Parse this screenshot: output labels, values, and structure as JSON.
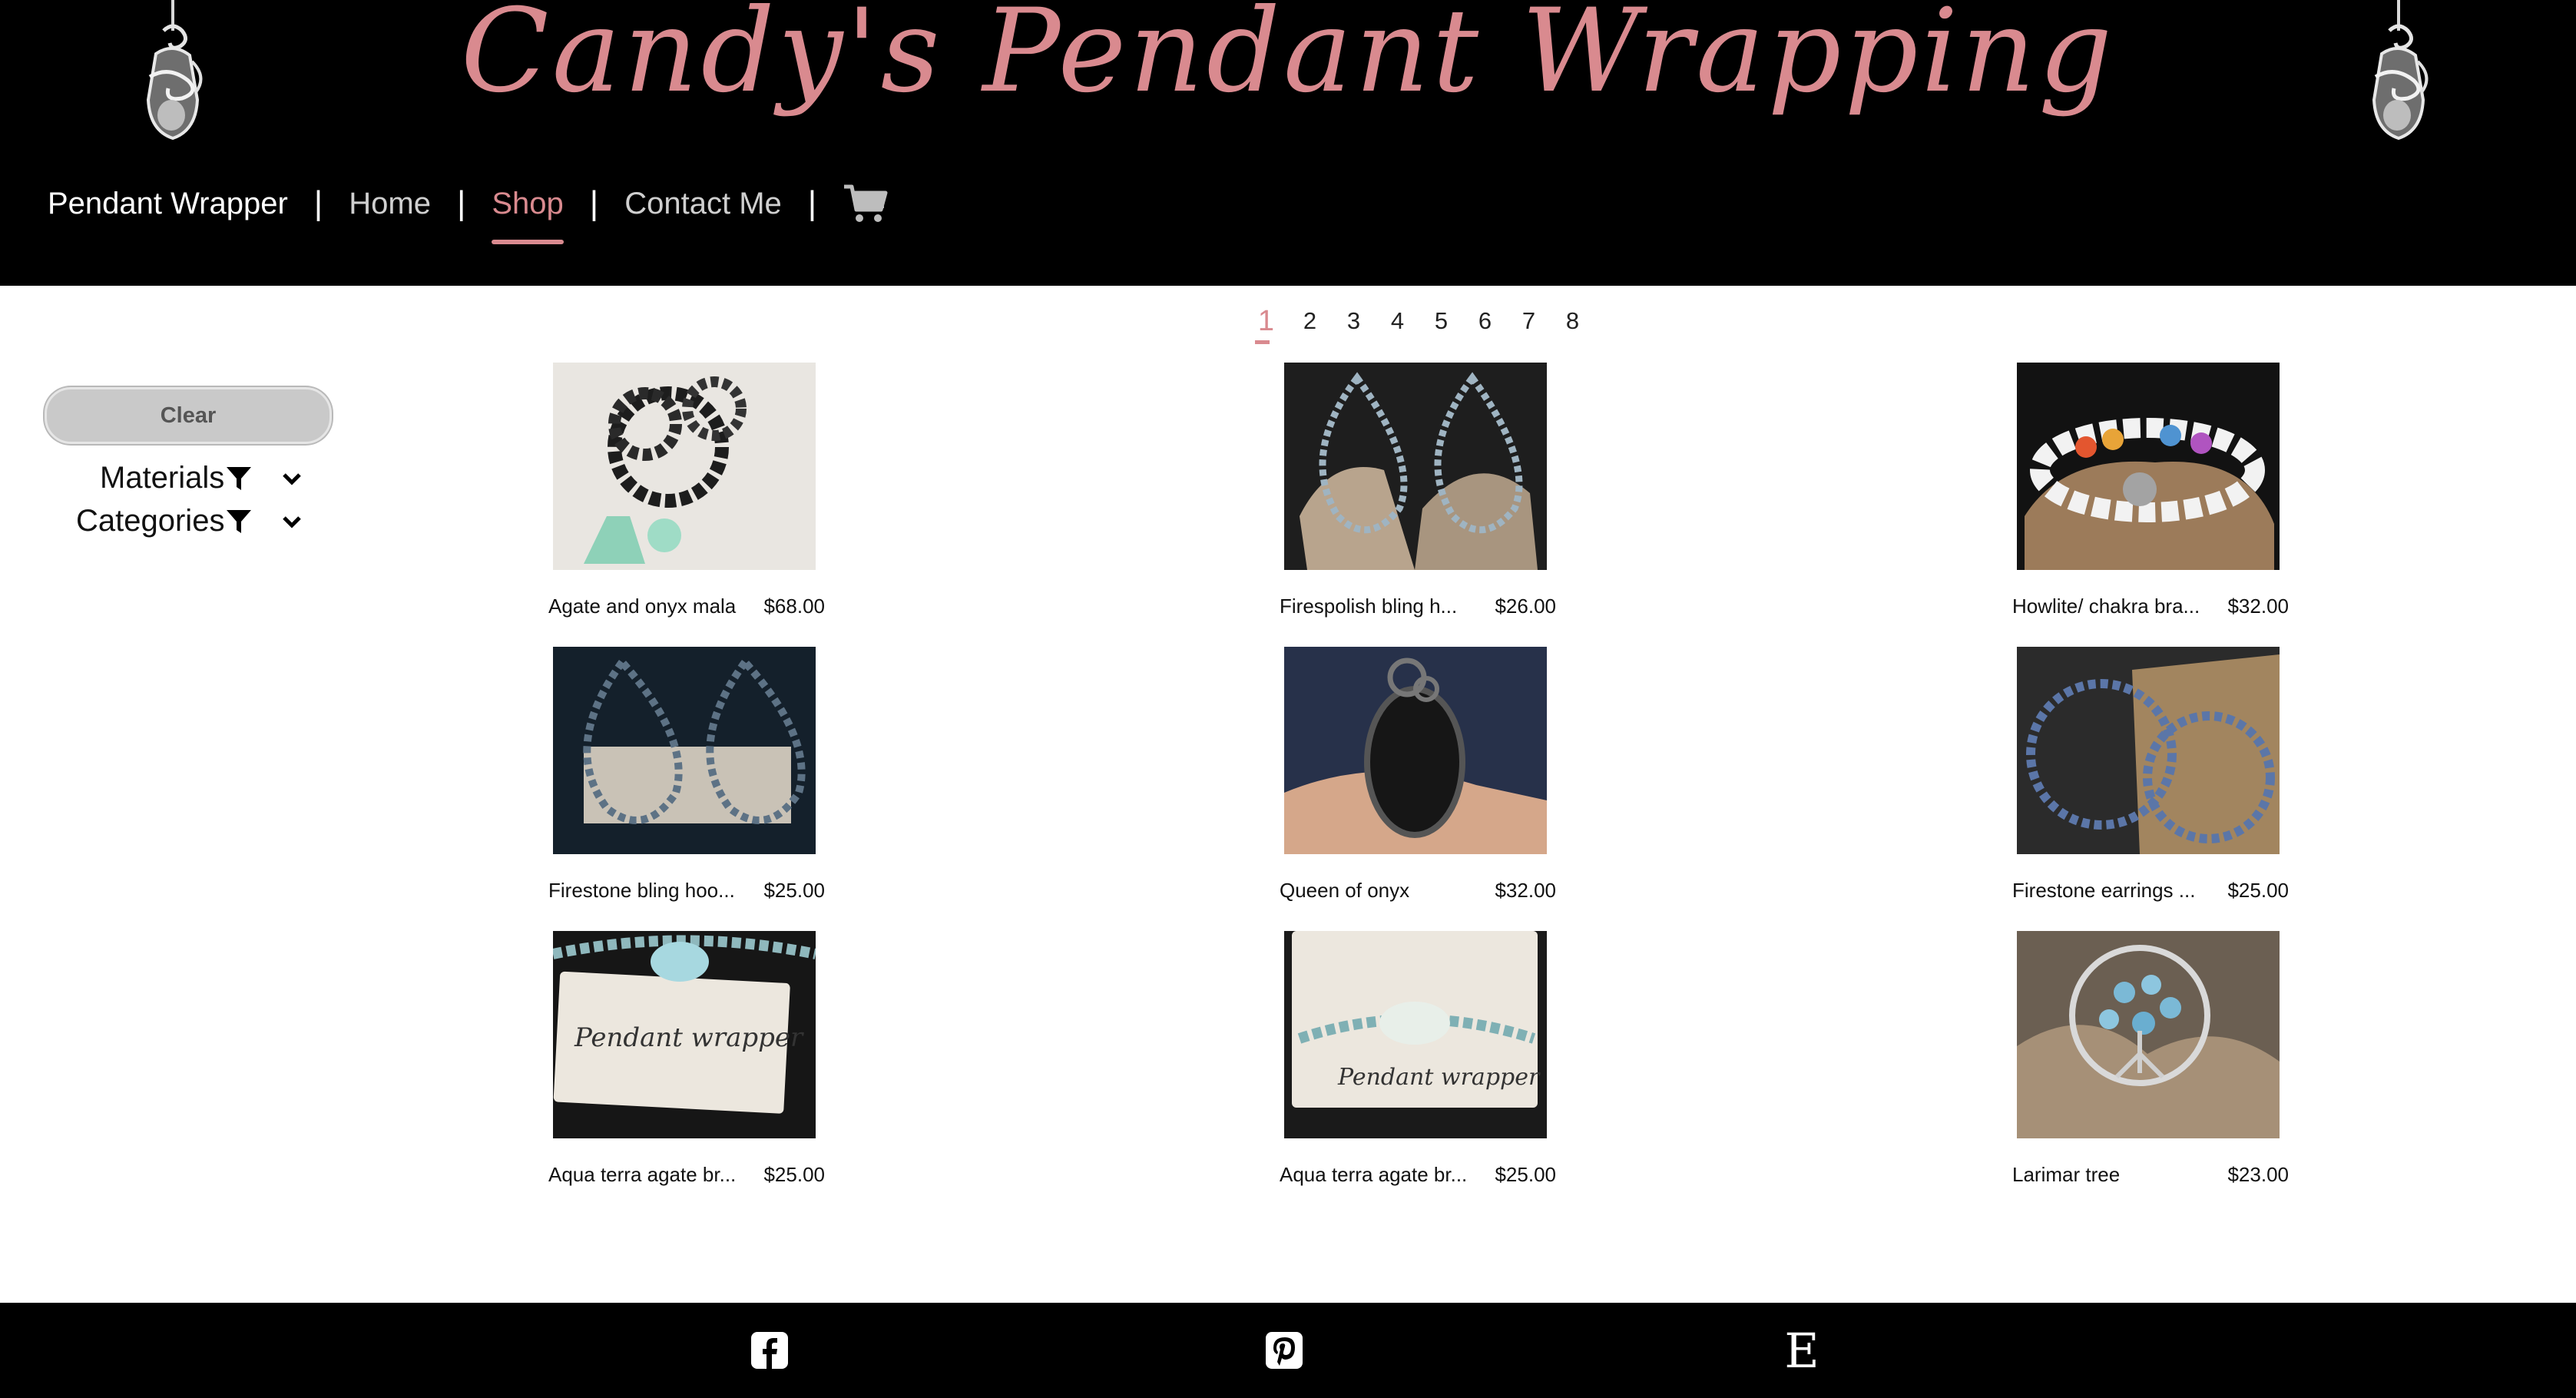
{
  "header": {
    "site_title": "Candy's Pendant Wrapping",
    "brand": "Pendant Wrapper",
    "nav": [
      {
        "label": "Home",
        "active": false
      },
      {
        "label": "Shop",
        "active": true
      },
      {
        "label": "Contact Me",
        "active": false
      }
    ],
    "separator": "|",
    "cart_icon": "shopping-cart-icon"
  },
  "pagination": {
    "pages": [
      "1",
      "2",
      "3",
      "4",
      "5",
      "6",
      "7",
      "8"
    ],
    "current": "1"
  },
  "sidebar": {
    "clear_label": "Clear",
    "filters": [
      {
        "label": "Materials",
        "icon": "filter-icon"
      },
      {
        "label": "Categories",
        "icon": "filter-icon"
      }
    ]
  },
  "products": [
    {
      "name": "Agate and onyx mala",
      "price": "$68.00"
    },
    {
      "name": "Firespolish bling h...",
      "price": "$26.00"
    },
    {
      "name": "Howlite/ chakra bra...",
      "price": "$32.00"
    },
    {
      "name": "Firestone bling hoo...",
      "price": "$25.00"
    },
    {
      "name": "Queen of onyx",
      "price": "$32.00"
    },
    {
      "name": "Firestone earrings ...",
      "price": "$25.00"
    },
    {
      "name": "Aqua terra agate br...",
      "price": "$25.00",
      "card_text": "Pendant wrapper"
    },
    {
      "name": "Aqua terra agate br...",
      "price": "$25.00",
      "card_text": "Pendant wrapper"
    },
    {
      "name": "Larimar tree",
      "price": "$23.00"
    }
  ],
  "footer": {
    "icons": [
      "facebook-icon",
      "pinterest-icon",
      "etsy-icon"
    ],
    "etsy_glyph": "E"
  },
  "colors": {
    "accent": "#d98a8f",
    "header_bg": "#000000",
    "clear_button_bg": "#c9c9c9"
  }
}
